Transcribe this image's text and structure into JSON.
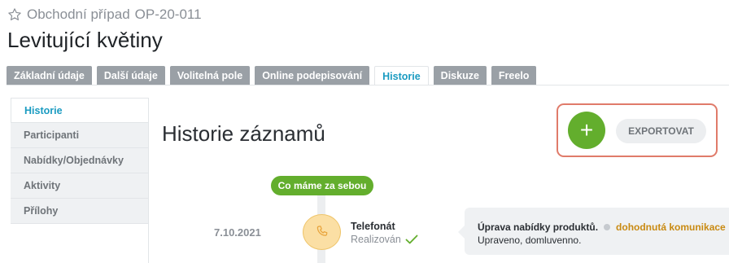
{
  "header": {
    "breadcrumb_label": "Obchodní případ",
    "breadcrumb_code": "OP-20-011",
    "title": "Levitující květiny"
  },
  "tabs": [
    {
      "label": "Základní údaje",
      "active": false
    },
    {
      "label": "Další údaje",
      "active": false
    },
    {
      "label": "Volitelná pole",
      "active": false
    },
    {
      "label": "Online podepisování",
      "active": false
    },
    {
      "label": "Historie",
      "active": true
    },
    {
      "label": "Diskuze",
      "active": false
    },
    {
      "label": "Freelo",
      "active": false
    }
  ],
  "sidebar": {
    "items": [
      {
        "label": "Historie",
        "active": true
      },
      {
        "label": "Participanti",
        "active": false
      },
      {
        "label": "Nabídky/Objednávky",
        "active": false
      },
      {
        "label": "Aktivity",
        "active": false
      },
      {
        "label": "Přílohy",
        "active": false
      }
    ]
  },
  "main": {
    "heading": "Historie záznamů",
    "add_label": "+",
    "export_label": "EXPORTOVAT"
  },
  "timeline": {
    "period_label": "Co máme za sebou",
    "events": [
      {
        "date": "7.10.2021",
        "icon": "phone-icon",
        "type": "Telefonát",
        "status": "Realizován",
        "text": "Úprava nabídky produktů.",
        "tag": "dohodnutá komunikace",
        "note": "Upraveno, domluvenno."
      }
    ]
  },
  "colors": {
    "accent": "#1a9bc1",
    "green": "#63ae2d",
    "highlight_border": "#e07b6a",
    "tag": "#c98a12",
    "phone_bg": "#fbdfa4"
  }
}
